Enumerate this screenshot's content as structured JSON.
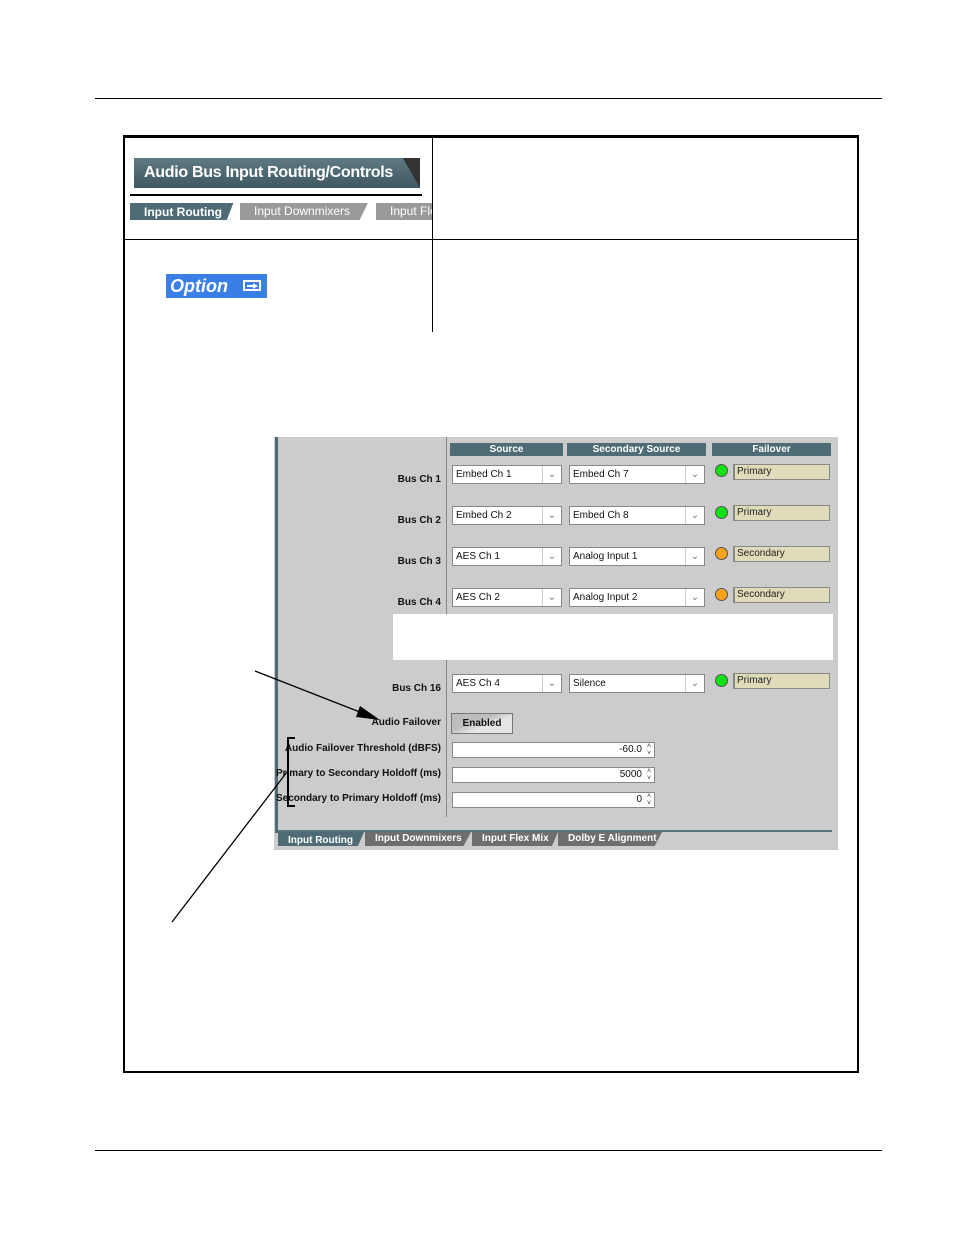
{
  "header_graphic": {
    "title": "Audio Bus Input Routing/Controls",
    "tabs": [
      "Input Routing",
      "Input Downmixers",
      "Input Fle"
    ]
  },
  "option_badge": {
    "label": "Option",
    "icon": "option-arrow-icon"
  },
  "panel": {
    "columns": [
      "Source",
      "Secondary Source",
      "Failover"
    ],
    "rows": [
      {
        "label": "Bus Ch 1",
        "source": "Embed Ch 1",
        "secondary": "Embed Ch 7",
        "status": "Primary",
        "led": "green"
      },
      {
        "label": "Bus Ch 2",
        "source": "Embed Ch 2",
        "secondary": "Embed Ch 8",
        "status": "Primary",
        "led": "green"
      },
      {
        "label": "Bus Ch 3",
        "source": "AES Ch 1",
        "secondary": "Analog Input 1",
        "status": "Secondary",
        "led": "orange"
      },
      {
        "label": "Bus Ch 4",
        "source": "AES Ch 2",
        "secondary": "Analog Input 2",
        "status": "Secondary",
        "led": "orange"
      },
      {
        "label": "Bus Ch 16",
        "source": "AES Ch 4",
        "secondary": "Silence",
        "status": "Primary",
        "led": "green"
      }
    ],
    "audio_failover": {
      "label": "Audio Failover",
      "value": "Enabled"
    },
    "settings": [
      {
        "label": "Audio Failover Threshold (dBFS)",
        "value": "-60.0"
      },
      {
        "label": "Primary to Secondary Holdoff (ms)",
        "value": "5000"
      },
      {
        "label": "Secondary to Primary Holdoff (ms)",
        "value": "0"
      }
    ],
    "bottom_tabs": [
      "Input Routing",
      "Input Downmixers",
      "Input Flex Mix",
      "Dolby E Alignment"
    ],
    "colors": {
      "led_green": "#12e012",
      "led_orange": "#f7a21b",
      "header": "#4f6c76"
    }
  }
}
